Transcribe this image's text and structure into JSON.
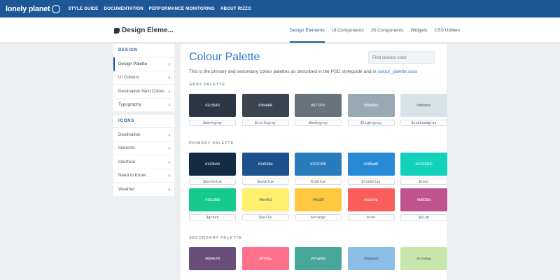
{
  "topbar": {
    "logo": "lonely planet",
    "nav": [
      "STYLE GUIDE",
      "DOCUMENTATION",
      "PERFORMANCE MONITORING",
      "ABOUT RIZZO"
    ]
  },
  "subbar": {
    "brand": "Design Eleme...",
    "tabs": [
      "Design Elements",
      "UI Components",
      "JS Components",
      "Widgets",
      "CSS Utilities"
    ],
    "active_tab": "Design Elements"
  },
  "sidebar": {
    "groups": [
      {
        "heading": "DESIGN",
        "items": [
          "Design Palette",
          "UI Colours",
          "Destination Next Colors",
          "Typography"
        ]
      },
      {
        "heading": "ICONS",
        "items": [
          "Destination",
          "Interests",
          "Interface",
          "Need to Know",
          "Weather"
        ]
      }
    ],
    "active_item": "Design Palette"
  },
  "main": {
    "title": "Colour Palette",
    "search_placeholder": "Find closest color",
    "description": "This is the primary and secondary colour palettes as described in the PSD styleguide and in ",
    "description_link": "colour_palette.sass",
    "sections": {
      "gray": {
        "label": "GRAY PALETTE",
        "rows": [
          [
            {
              "hex": "#2c3643",
              "var": "$darkgray"
            },
            {
              "hex": "#3b444f",
              "var": "$titlegray"
            },
            {
              "hex": "#67747c",
              "var": "$bodygray"
            },
            {
              "hex": "#99a9b3",
              "var": "$lightgray"
            },
            {
              "hex": "#dbebec",
              "var": "$subduedgray",
              "display": "#dbebec",
              "fill": "#d8e3e8",
              "dark_text": true
            }
          ]
        ]
      },
      "primary": {
        "label": "PRIMARY PALETTE",
        "rows": [
          [
            {
              "hex": "#142b44",
              "var": "$darkblue"
            },
            {
              "hex": "#1d508d",
              "var": "$navblue"
            },
            {
              "hex": "#297CBB",
              "var": "$lpblue"
            },
            {
              "hex": "#288ad6",
              "var": "$linkblue"
            },
            {
              "hex": "#0FDEBD",
              "var": "$teal",
              "fill": "#12d2bc"
            }
          ],
          [
            {
              "hex": "#16c98d",
              "var": "$green"
            },
            {
              "hex": "#feef6d",
              "var": "$yella",
              "dark_text": true
            },
            {
              "hex": "#ffc83f",
              "var": "$orange",
              "dark_text": true
            },
            {
              "hex": "#fa5e5b",
              "var": "$red"
            },
            {
              "hex": "#bf538d",
              "var": "$plum"
            }
          ]
        ]
      },
      "secondary": {
        "label": "SECONDARY PALETTE",
        "rows": [
          [
            {
              "hex": "#684e79",
              "var": ""
            },
            {
              "hex": "#ff708a",
              "var": ""
            },
            {
              "hex": "#47a899",
              "var": ""
            },
            {
              "hex": "#8abee5",
              "var": "",
              "dark_text": true
            },
            {
              "hex": "#c7e6aa",
              "var": "",
              "dark_text": true
            }
          ]
        ]
      }
    }
  }
}
